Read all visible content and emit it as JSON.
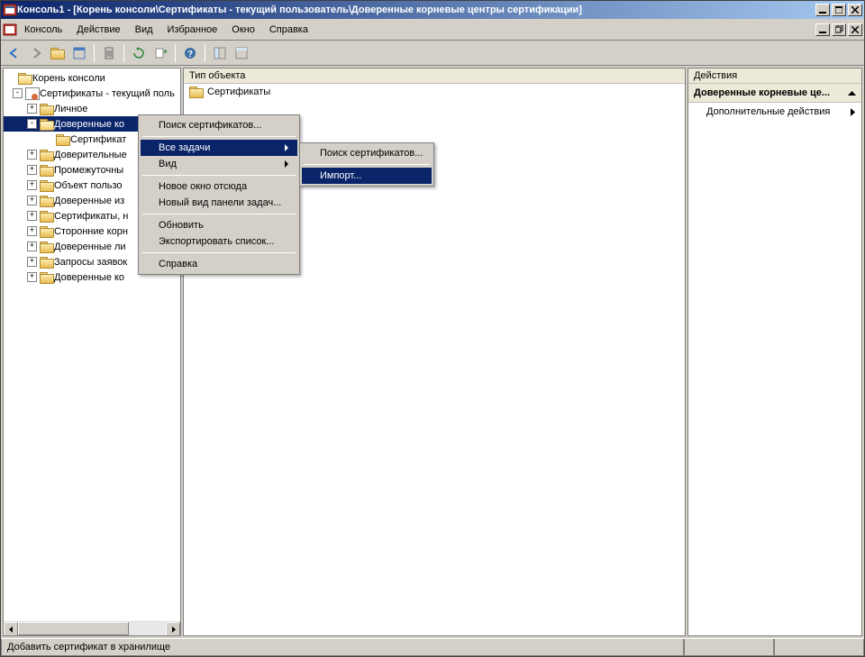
{
  "title": "Консоль1 - [Корень консоли\\Сертификаты - текущий пользователь\\Доверенные корневые центры сертификации]",
  "menubar": {
    "items": [
      "Консоль",
      "Действие",
      "Вид",
      "Избранное",
      "Окно",
      "Справка"
    ]
  },
  "tree": {
    "root": "Корень консоли",
    "certs": "Сертификаты - текущий поль",
    "nodes": [
      {
        "label": "Личное",
        "exp": "+"
      },
      {
        "label": "Доверенные ко",
        "exp": "-",
        "selected": true
      },
      {
        "label": "Сертификат",
        "child": true
      },
      {
        "label": "Доверительные",
        "exp": "+"
      },
      {
        "label": "Промежуточны",
        "exp": "+"
      },
      {
        "label": "Объект пользо",
        "exp": "+"
      },
      {
        "label": "Доверенные из",
        "exp": "+"
      },
      {
        "label": "Сертификаты, н",
        "exp": "+"
      },
      {
        "label": "Сторонние корн",
        "exp": "+"
      },
      {
        "label": "Доверенные ли",
        "exp": "+"
      },
      {
        "label": "Запросы заявок",
        "exp": "+"
      },
      {
        "label": "Доверенные ко",
        "exp": "+"
      }
    ]
  },
  "middle": {
    "header": "Тип объекта",
    "rows": [
      "Сертификаты"
    ]
  },
  "actions": {
    "header": "Действия",
    "section": "Доверенные корневые це...",
    "items": [
      "Дополнительные действия"
    ]
  },
  "context_menu": {
    "items": [
      {
        "label": "Поиск сертификатов..."
      },
      {
        "sep": true
      },
      {
        "label": "Все задачи",
        "sub": true,
        "highlighted": true
      },
      {
        "label": "Вид",
        "sub": true
      },
      {
        "sep": true
      },
      {
        "label": "Новое окно отсюда"
      },
      {
        "label": "Новый вид панели задач..."
      },
      {
        "sep": true
      },
      {
        "label": "Обновить"
      },
      {
        "label": "Экспортировать список..."
      },
      {
        "sep": true
      },
      {
        "label": "Справка"
      }
    ],
    "submenu": [
      {
        "label": "Поиск сертификатов..."
      },
      {
        "sep": true
      },
      {
        "label": "Импорт...",
        "highlighted": true
      }
    ]
  },
  "statusbar": "Добавить сертификат в хранилище"
}
